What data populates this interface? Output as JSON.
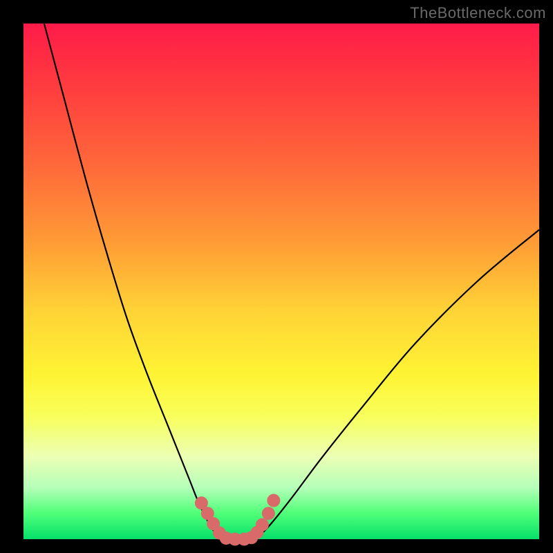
{
  "watermark": "TheBottleneck.com",
  "colors": {
    "background": "#000000",
    "gradient_top": "#ff1b49",
    "gradient_bottom": "#05d268",
    "curve": "#000000",
    "marker_fill": "#d86a6a",
    "marker_stroke": "#bb4e4e"
  },
  "chart_data": {
    "type": "line",
    "title": "",
    "xlabel": "",
    "ylabel": "",
    "xlim": [
      0,
      100
    ],
    "ylim": [
      0,
      100
    ],
    "series": [
      {
        "name": "left-branch",
        "x": [
          4,
          8,
          12,
          16,
          20,
          24,
          28,
          32,
          34,
          36,
          37,
          38,
          39
        ],
        "y": [
          100,
          85,
          70,
          56,
          43,
          32,
          22,
          12,
          7,
          3,
          1.5,
          0.5,
          0
        ]
      },
      {
        "name": "flat-bottom",
        "x": [
          39,
          44
        ],
        "y": [
          0,
          0
        ]
      },
      {
        "name": "right-branch",
        "x": [
          44,
          46,
          48,
          52,
          58,
          66,
          76,
          88,
          100
        ],
        "y": [
          0,
          1,
          3,
          8,
          16,
          26,
          38,
          50,
          60
        ]
      }
    ],
    "markers": {
      "name": "bottom-cluster",
      "points": [
        {
          "x": 34.5,
          "y": 7.0
        },
        {
          "x": 35.7,
          "y": 5.0
        },
        {
          "x": 36.8,
          "y": 3.0
        },
        {
          "x": 38.0,
          "y": 1.2
        },
        {
          "x": 39.3,
          "y": 0.2
        },
        {
          "x": 41.0,
          "y": 0.0
        },
        {
          "x": 42.8,
          "y": 0.0
        },
        {
          "x": 44.2,
          "y": 0.3
        },
        {
          "x": 45.3,
          "y": 1.3
        },
        {
          "x": 46.3,
          "y": 2.8
        },
        {
          "x": 47.5,
          "y": 5.0
        },
        {
          "x": 48.5,
          "y": 7.5
        }
      ]
    }
  }
}
